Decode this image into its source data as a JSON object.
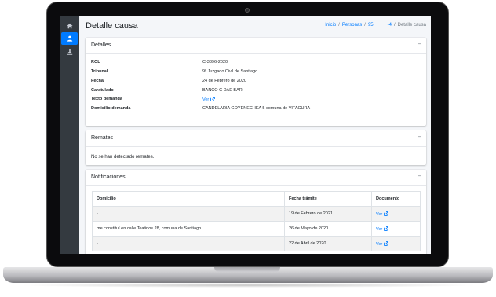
{
  "header": {
    "title": "Detalle causa",
    "breadcrumb": [
      "Inicio",
      "Personas",
      "95      -4",
      "Detalle causa"
    ]
  },
  "sidebar": {
    "items": [
      {
        "icon": "home-icon"
      },
      {
        "icon": "user-icon"
      },
      {
        "icon": "download-icon"
      }
    ]
  },
  "detalles": {
    "title": "Detalles",
    "tool": "–",
    "rows": [
      {
        "label": "ROL",
        "value": "C-3896-2020"
      },
      {
        "label": "Tribunal",
        "value": "9º Juzgado Civil de Santiago"
      },
      {
        "label": "Fecha",
        "value": "24 de Febrero de 2020"
      },
      {
        "label": "Caratulado",
        "value": "BANCO C                    DAE                    BAR"
      },
      {
        "label": "Texto demanda",
        "value": "Ver"
      },
      {
        "label": "Domicilio demanda",
        "value": "CANDELARIA GOYENECHEA 5            comuna de VITACURA"
      }
    ]
  },
  "remates": {
    "title": "Remates",
    "tool": "–",
    "empty_text": "No se han detectado remates."
  },
  "notificaciones": {
    "title": "Notificaciones",
    "tool": "–",
    "columns": [
      "Domicilio",
      "Fecha trámite",
      "Documento"
    ],
    "rows": [
      {
        "domicilio": "-",
        "fecha": "19 de Febrero de 2021",
        "documento": "Ver"
      },
      {
        "domicilio": "me constituí en calle Teatinos 28, comuna de Santiago.",
        "fecha": "26 de Mayo de 2020",
        "documento": "Ver"
      },
      {
        "domicilio": "-",
        "fecha": "22 de Abril de 2020",
        "documento": "Ver"
      }
    ]
  },
  "colors": {
    "accent": "#007bff",
    "sidebar_bg": "#343a40",
    "page_bg": "#f4f6f9"
  }
}
